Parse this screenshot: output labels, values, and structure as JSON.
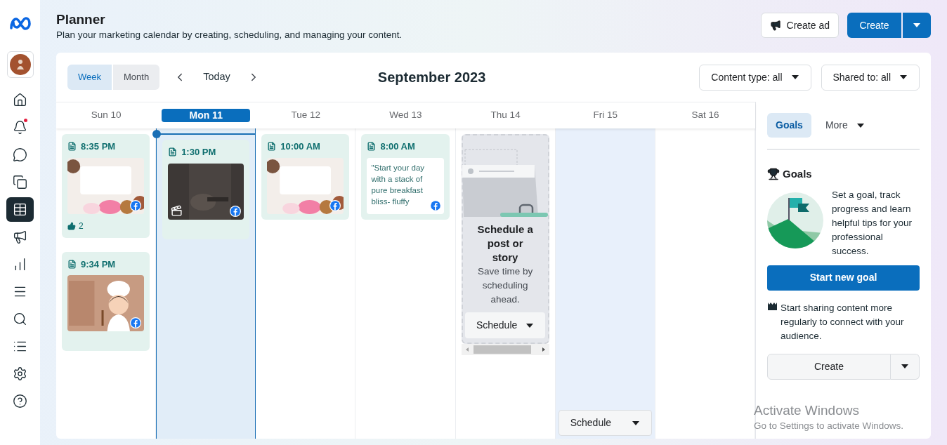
{
  "sidebar": {
    "items": [
      {
        "kind": "home",
        "selected": false,
        "notification": false
      },
      {
        "kind": "bell",
        "selected": false,
        "notification": true
      },
      {
        "kind": "chat",
        "selected": false,
        "notification": false
      },
      {
        "kind": "pages",
        "selected": false,
        "notification": false
      },
      {
        "kind": "calendar",
        "selected": true,
        "notification": false
      },
      {
        "kind": "megaphone",
        "selected": false,
        "notification": false
      },
      {
        "kind": "chart",
        "selected": false,
        "notification": false
      },
      {
        "kind": "menu",
        "selected": false,
        "notification": false
      },
      {
        "kind": "search",
        "selected": false,
        "notification": false
      },
      {
        "kind": "list",
        "selected": false,
        "notification": false
      },
      {
        "kind": "settings",
        "selected": false,
        "notification": false
      },
      {
        "kind": "help",
        "selected": false,
        "notification": false
      }
    ]
  },
  "header": {
    "title": "Planner",
    "subtitle": "Plan your marketing calendar by creating, scheduling, and managing your content.",
    "buttons": [
      {
        "kind": "secondary",
        "label": "Create ad"
      },
      {
        "kind": "primary",
        "label": "Create"
      }
    ]
  },
  "toolbar": {
    "views": [
      {
        "label": "Week",
        "selected": true
      },
      {
        "label": "Month",
        "selected": false
      }
    ],
    "today": "Today",
    "period": "September 2023",
    "filters": [
      "Content type: all",
      "Shared to: all"
    ]
  },
  "days": [
    {
      "label": "Sun 10",
      "selected": false,
      "hovered": false,
      "posts": [
        {
          "time": "8:35 PM",
          "likes": "2"
        },
        {
          "time": "9:34 PM"
        }
      ]
    },
    {
      "label": "Mon 11",
      "selected": true,
      "hovered": false,
      "posts": [
        {
          "time": "1:30 PM",
          "kind": "reel"
        }
      ]
    },
    {
      "label": "Tue 12",
      "selected": false,
      "hovered": false,
      "posts": [
        {
          "time": "10:00 AM"
        }
      ]
    },
    {
      "label": "Wed 13",
      "selected": false,
      "hovered": false,
      "posts": [
        {
          "time": "8:00 AM",
          "kind": "text",
          "text": "\"Start your day with a stack of pure breakfast bliss- fluffy"
        }
      ]
    },
    {
      "label": "Thu 14",
      "selected": false,
      "hovered": false,
      "prompt": {
        "title": "Schedule a post or story",
        "text": "Save time by scheduling ahead.",
        "button": "Schedule"
      }
    },
    {
      "label": "Fri 15",
      "selected": false,
      "hovered": true,
      "hover_button": "Schedule"
    },
    {
      "label": "Sat 16",
      "selected": false,
      "hovered": false
    }
  ],
  "panel": {
    "tabs": [
      {
        "label": "Goals",
        "selected": true
      },
      {
        "label": "More",
        "selected": false
      }
    ],
    "heading": "Goals",
    "description": "Set a goal, track progress and learn helpful tips for your professional success.",
    "primary_button": "Start new goal",
    "tip": "Start sharing content more regularly to connect with your audience.",
    "create_button": "Create"
  },
  "os_notice": {
    "title": "Activate Windows",
    "text": "Go to Settings to activate Windows."
  }
}
